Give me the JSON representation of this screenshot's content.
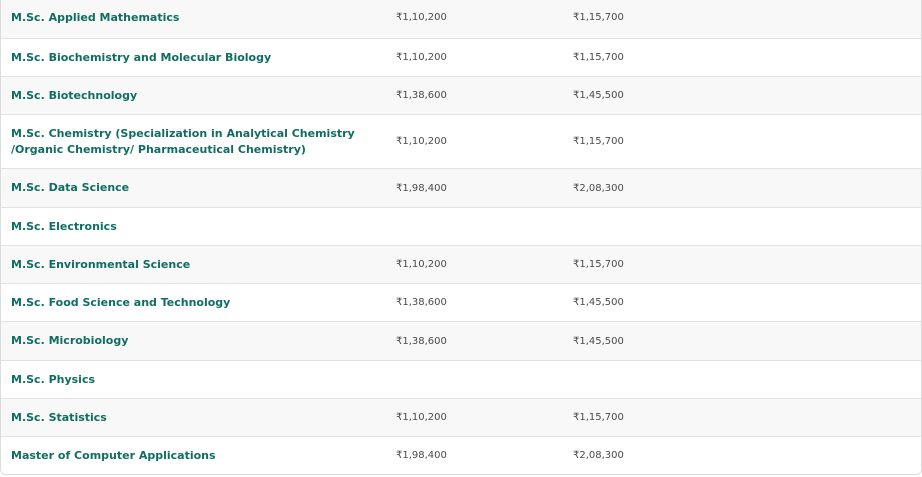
{
  "table": {
    "rows": [
      {
        "course": "M.Sc. Applied Mathematics",
        "fee1": "₹1,10,200",
        "fee2": "₹1,15,700"
      },
      {
        "course": "M.Sc. Biochemistry and Molecular Biology",
        "fee1": "₹1,10,200",
        "fee2": "₹1,15,700"
      },
      {
        "course": "M.Sc. Biotechnology",
        "fee1": "₹1,38,600",
        "fee2": "₹1,45,500"
      },
      {
        "course": "M.Sc. Chemistry (Specialization in Analytical Chemistry /Organic Chemistry/ Pharmaceutical Chemistry)",
        "fee1": "₹1,10,200",
        "fee2": "₹1,15,700"
      },
      {
        "course": "M.Sc. Data Science",
        "fee1": "₹1,98,400",
        "fee2": "₹2,08,300"
      },
      {
        "course": "M.Sc. Electronics",
        "fee1": "",
        "fee2": ""
      },
      {
        "course": "M.Sc. Environmental Science",
        "fee1": "₹1,10,200",
        "fee2": "₹1,15,700"
      },
      {
        "course": "M.Sc. Food Science and Technology",
        "fee1": "₹1,38,600",
        "fee2": "₹1,45,500"
      },
      {
        "course": "M.Sc. Microbiology",
        "fee1": "₹1,38,600",
        "fee2": "₹1,45,500"
      },
      {
        "course": "M.Sc. Physics",
        "fee1": "",
        "fee2": ""
      },
      {
        "course": "M.Sc. Statistics",
        "fee1": "₹1,10,200",
        "fee2": "₹1,15,700"
      },
      {
        "course": "Master of Computer Applications",
        "fee1": "₹1,98,400",
        "fee2": "₹2,08,300"
      }
    ]
  }
}
